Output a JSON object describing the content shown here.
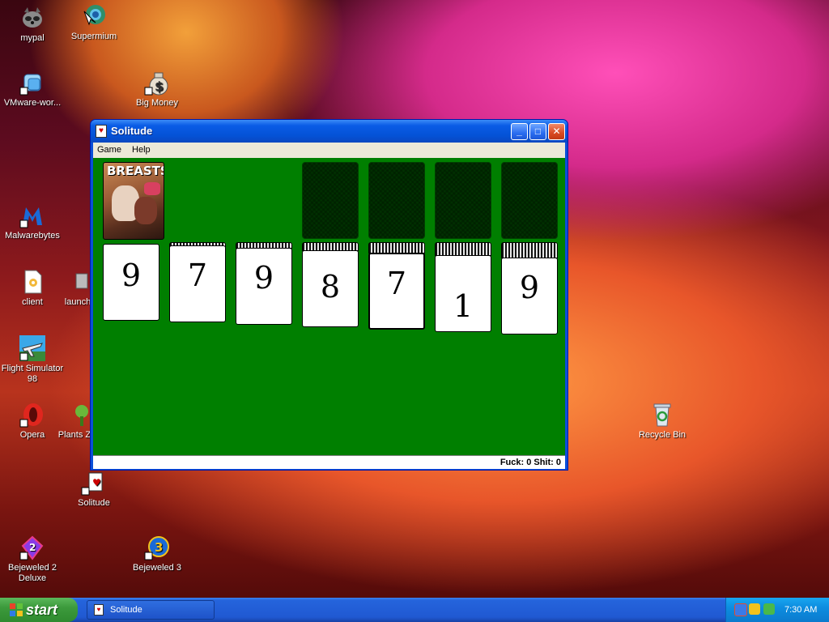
{
  "desktop": {
    "icons": [
      {
        "label": "mypal"
      },
      {
        "label": "Supermium"
      },
      {
        "label": "VMware-wor..."
      },
      {
        "label": "Big Money"
      },
      {
        "label": "Malwarebytes"
      },
      {
        "label": "client"
      },
      {
        "label": "launch"
      },
      {
        "label": "Flight Simulator 98"
      },
      {
        "label": "Opera"
      },
      {
        "label": "Plants Zo"
      },
      {
        "label": "Solitude"
      },
      {
        "label": "Recycle Bin"
      },
      {
        "label": "Bejeweled 2 Deluxe"
      },
      {
        "label": "Bejeweled 3"
      }
    ]
  },
  "window": {
    "title": "Solitude",
    "controls": {
      "minimize": "_",
      "maximize": "□",
      "close": "✕"
    },
    "menu": [
      "Game",
      "Help"
    ],
    "stock_card_text": "BREASTS",
    "tableau": [
      {
        "rank": "9"
      },
      {
        "rank": "7"
      },
      {
        "rank": "9"
      },
      {
        "rank": "8"
      },
      {
        "rank": "7"
      },
      {
        "rank": "1"
      },
      {
        "rank": "9"
      }
    ],
    "status": "Fuck: 0 Shit: 0"
  },
  "taskbar": {
    "start_label": "start",
    "task_item": "Solitude",
    "clock": "7:30 AM"
  },
  "colors": {
    "felt": "#007f00",
    "titlebar": "#0452d6",
    "taskbar": "#2059d2",
    "start": "#3c9a3c"
  }
}
